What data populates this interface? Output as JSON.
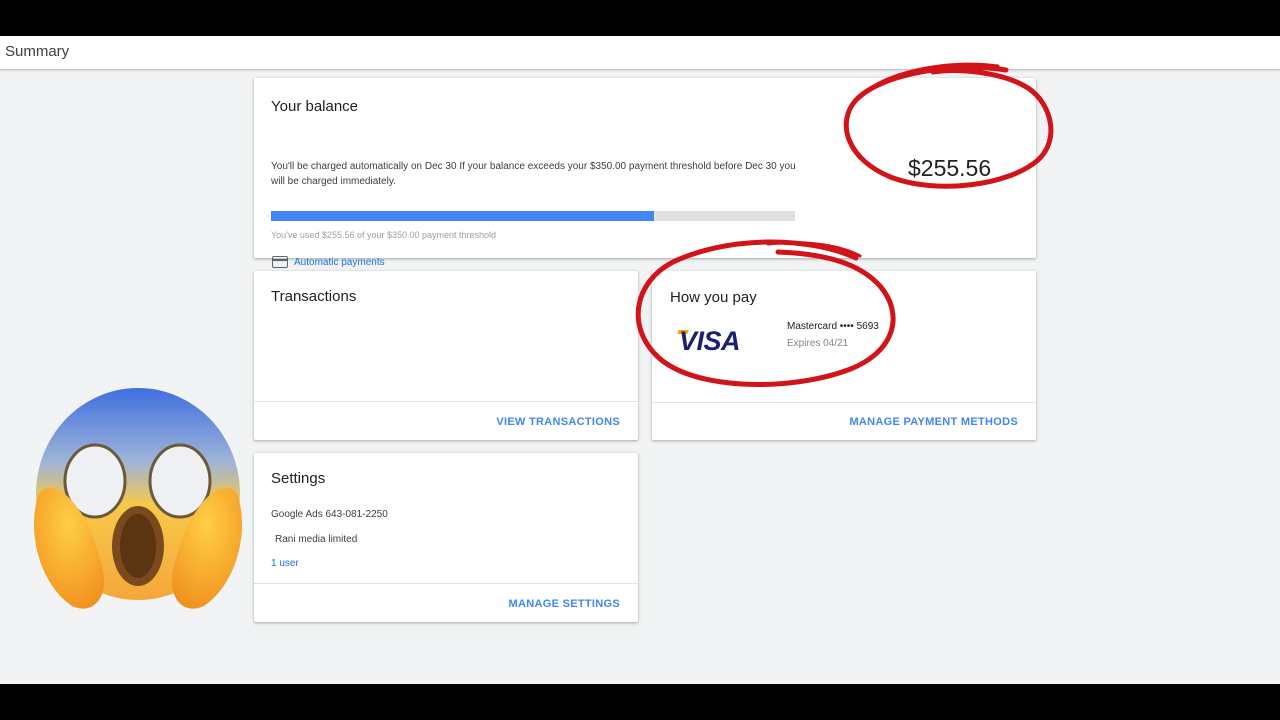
{
  "header": {
    "title": "Summary"
  },
  "balance": {
    "title": "Your balance",
    "description_line1": "You'll be charged automatically on Dec 30 If your balance exceeds your $350.00      payment threshold before Dec 30 you",
    "description_line2": "will be charged immediately.",
    "progress_fraction": 0.73,
    "progress_caption": "You've used $255.56 of your $350.00 payment threshold",
    "auto_payments_label": "Automatic payments",
    "amount": "$255.56"
  },
  "transactions": {
    "title": "Transactions",
    "action_label": "VIEW TRANSACTIONS"
  },
  "payment": {
    "title": "How you pay",
    "card_brand_logo": "VISA",
    "card_label": "Mastercard •••• 5693",
    "expires_label": "Expires 04/21",
    "action_label": "MANAGE PAYMENT METHODS"
  },
  "settings": {
    "title": "Settings",
    "account_line": "Google Ads 643-081-2250",
    "business_name": "Rani media limited",
    "users_link": "1 user",
    "action_label": "MANAGE SETTINGS"
  },
  "colors": {
    "accent_blue": "#4285f4",
    "annotation_red": "#d0141a",
    "page_background": "#f1f3f4"
  },
  "icons": [
    "credit-card-icon",
    "screaming-face-emoji",
    "mouse-cursor-icon"
  ]
}
